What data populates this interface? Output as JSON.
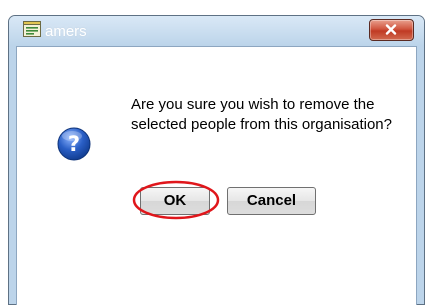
{
  "window": {
    "title": "amers",
    "title_icon": "form-icon",
    "close_icon": "close-x-icon"
  },
  "dialog": {
    "icon": "question-icon",
    "message": "Are you sure you wish to remove the selected people from this organisation?",
    "buttons": {
      "ok_label": "OK",
      "cancel_label": "Cancel"
    }
  },
  "annotation": {
    "highlight": "OK button circled in red",
    "color": "#e0161b"
  },
  "colors": {
    "frame": "#bcd4ea",
    "close_button": "#c7432b",
    "question_icon": "#1f53b4"
  }
}
